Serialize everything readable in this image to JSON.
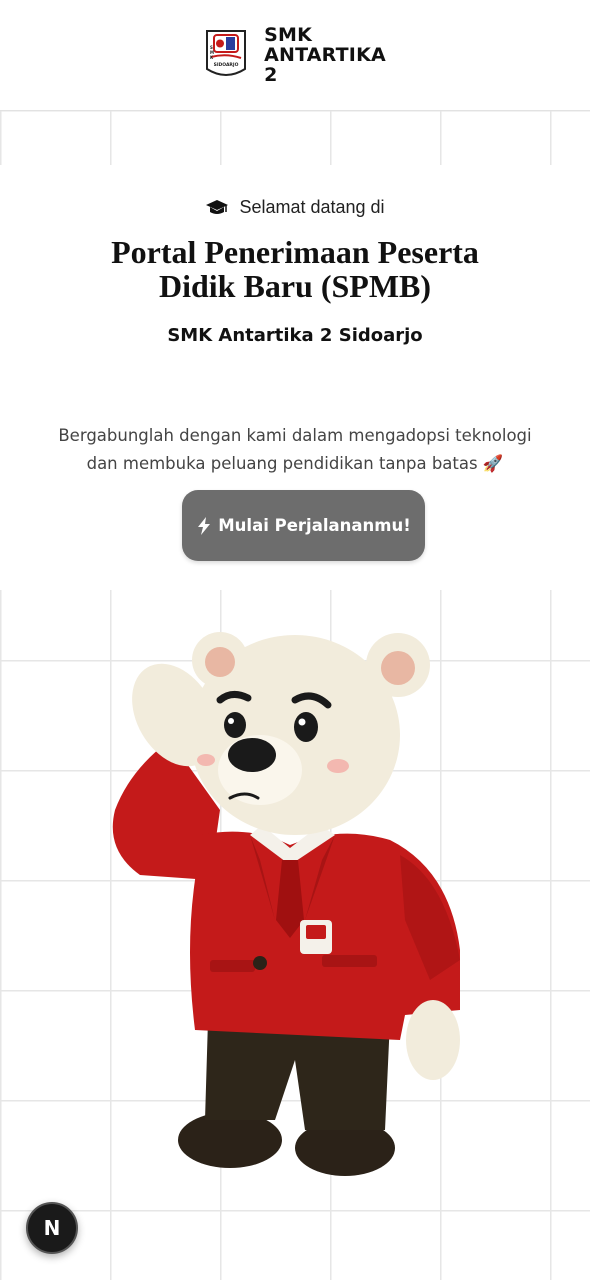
{
  "header": {
    "brand_line1": "SMK",
    "brand_line2": "ANTARTIKA",
    "brand_line3": "2",
    "logo_text": "SIDOARJO"
  },
  "hero": {
    "welcome": "Selamat datang di",
    "title_line1": "Portal Penerimaan Peserta",
    "title_line2": "Didik Baru (SPMB)",
    "subtitle": "SMK Antartika 2 Sidoarjo",
    "desc_line1": "Bergabunglah dengan kami dalam mengadopsi teknologi",
    "desc_line2": "dan membuka peluang pendidikan tanpa batas 🚀",
    "cta_label": "Mulai Perjalananmu!"
  },
  "badge": {
    "label": "N"
  },
  "colors": {
    "button_bg": "#6d6d6d",
    "blazer_red": "#c41a1a",
    "bear_fur": "#f2ecdc",
    "grid_line": "#e6e6e6"
  },
  "icons": {
    "welcome_icon": "graduation-cap-icon",
    "cta_icon": "lightning-icon",
    "badge_icon": "nextjs-icon"
  }
}
